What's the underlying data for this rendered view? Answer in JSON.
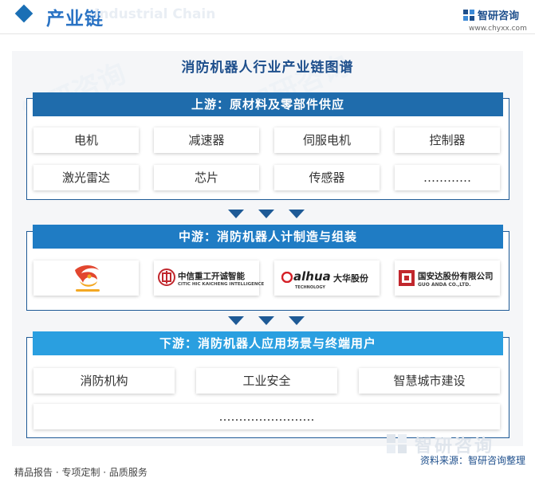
{
  "header": {
    "title": "产业链",
    "watermark": "Industrial Chain"
  },
  "brand": {
    "name": "智研咨询",
    "url": "www.chyxx.com",
    "watermark": "智研咨询",
    "color": "#1e4f8c"
  },
  "diagram": {
    "title": "消防机器人行业产业链图谱",
    "upstream": {
      "label": "上游：原材料及零部件供应",
      "items": [
        "电机",
        "减速器",
        "伺服电机",
        "控制器",
        "激光雷达",
        "芯片",
        "传感器",
        "…………"
      ]
    },
    "midstream": {
      "label": "中游：消防机器人计制造与组装",
      "companies": [
        {
          "name": "",
          "logo": "dragon-logo",
          "colors": [
            "#e2462f",
            "#f3a823"
          ]
        },
        {
          "name": "中信重工开诚智能",
          "sub": "CITIC HIC KAICHENG INTELLIGENCE",
          "logo": "citic-logo"
        },
        {
          "name": "alhua",
          "suffix": "大华股份",
          "sub": "TECHNOLOGY",
          "logo": "dahua-logo"
        },
        {
          "name": "国安达股份有限公司",
          "sub": "GUO ANDA  CO.,LTD.",
          "logo": "guoanda-logo"
        }
      ]
    },
    "downstream": {
      "label": "下游：消防机器人应用场景与终端用户",
      "items": [
        "消防机构",
        "工业安全",
        "智慧城市建设",
        "……………………"
      ]
    }
  },
  "footer": {
    "left": "精品报告 · 专项定制 · 品质服务",
    "source": "资料来源：智研咨询整理"
  },
  "colors": {
    "up_banner": "#1f6cac",
    "mid_banner": "#1f7cc4",
    "down_banner": "#2a9fe0",
    "border": "#1e5a96"
  }
}
